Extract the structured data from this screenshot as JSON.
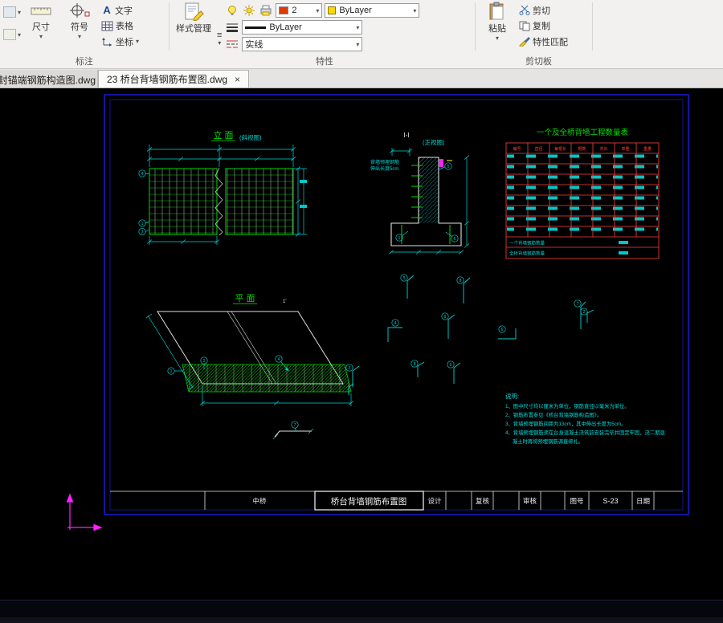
{
  "ribbon": {
    "annotation": {
      "label": "标注",
      "dimension": "尺寸",
      "symbol": "符号",
      "text": "文字",
      "text_icon": "A",
      "table": "表格",
      "coordinate": "坐标"
    },
    "properties": {
      "label": "特性",
      "style_manager": "样式管理",
      "menu_icon": "≡",
      "color_value": "2",
      "layer_value": "ByLayer",
      "lineweight_value": "ByLayer",
      "linetype_value": "实线"
    },
    "clipboard": {
      "label": "剪切板",
      "paste": "粘贴",
      "cut": "剪切",
      "copy": "复制",
      "match_props": "特性匹配"
    }
  },
  "tabs": {
    "tab1": "封锚端钢筋构造图.dwg",
    "tab2": "23 桥台背墙钢筋布置图.dwg",
    "close": "×"
  },
  "drawing": {
    "elevation": {
      "title": "立 面",
      "subtitle": "(斜视图)"
    },
    "section": {
      "title": "I-I",
      "subtitle": "(正视图)",
      "note1": "背墙预埋钢筋",
      "note2": "伸出长度5cm"
    },
    "plan": {
      "title": "平 面",
      "mark": "1'"
    },
    "table": {
      "title": "一个及全桥背墙工程数量表",
      "headers": [
        "编号",
        "直径",
        "每根长",
        "根数",
        "共长",
        "单重",
        "重量"
      ],
      "footer1": "一个背墙钢筋数量",
      "footer2": "全桥背墙钢筋数量"
    },
    "notes": {
      "heading": "说明:",
      "line1": "1、图中尺寸均以厘米为单位，钢筋直径以毫米为单位。",
      "line2": "2、钢筋布置参见《桥台背墙钢筋构造图》。",
      "line3": "3、背墙预埋钢筋间距为13cm，其中伸出长度为5cm。",
      "line4": "4、背墙预埋钢筋须在台身混凝土浇筑前安装完毕并固定牢固，浇二期混",
      "line5": "凝土时再将预埋钢筋调直绑扎。"
    },
    "callouts": {
      "c1": "1",
      "c2": "2",
      "c3": "3",
      "c4": "4",
      "c5": "5",
      "c6": "6",
      "c7": "7",
      "c8": "8",
      "c9": "9"
    },
    "titleblock": {
      "bridge": "中桥",
      "title": "桥台背墙钢筋布置图",
      "design": "设计",
      "check": "复核",
      "review": "审核",
      "sheet_label": "图号",
      "sheet_no": "S-23",
      "date": "日期"
    }
  }
}
